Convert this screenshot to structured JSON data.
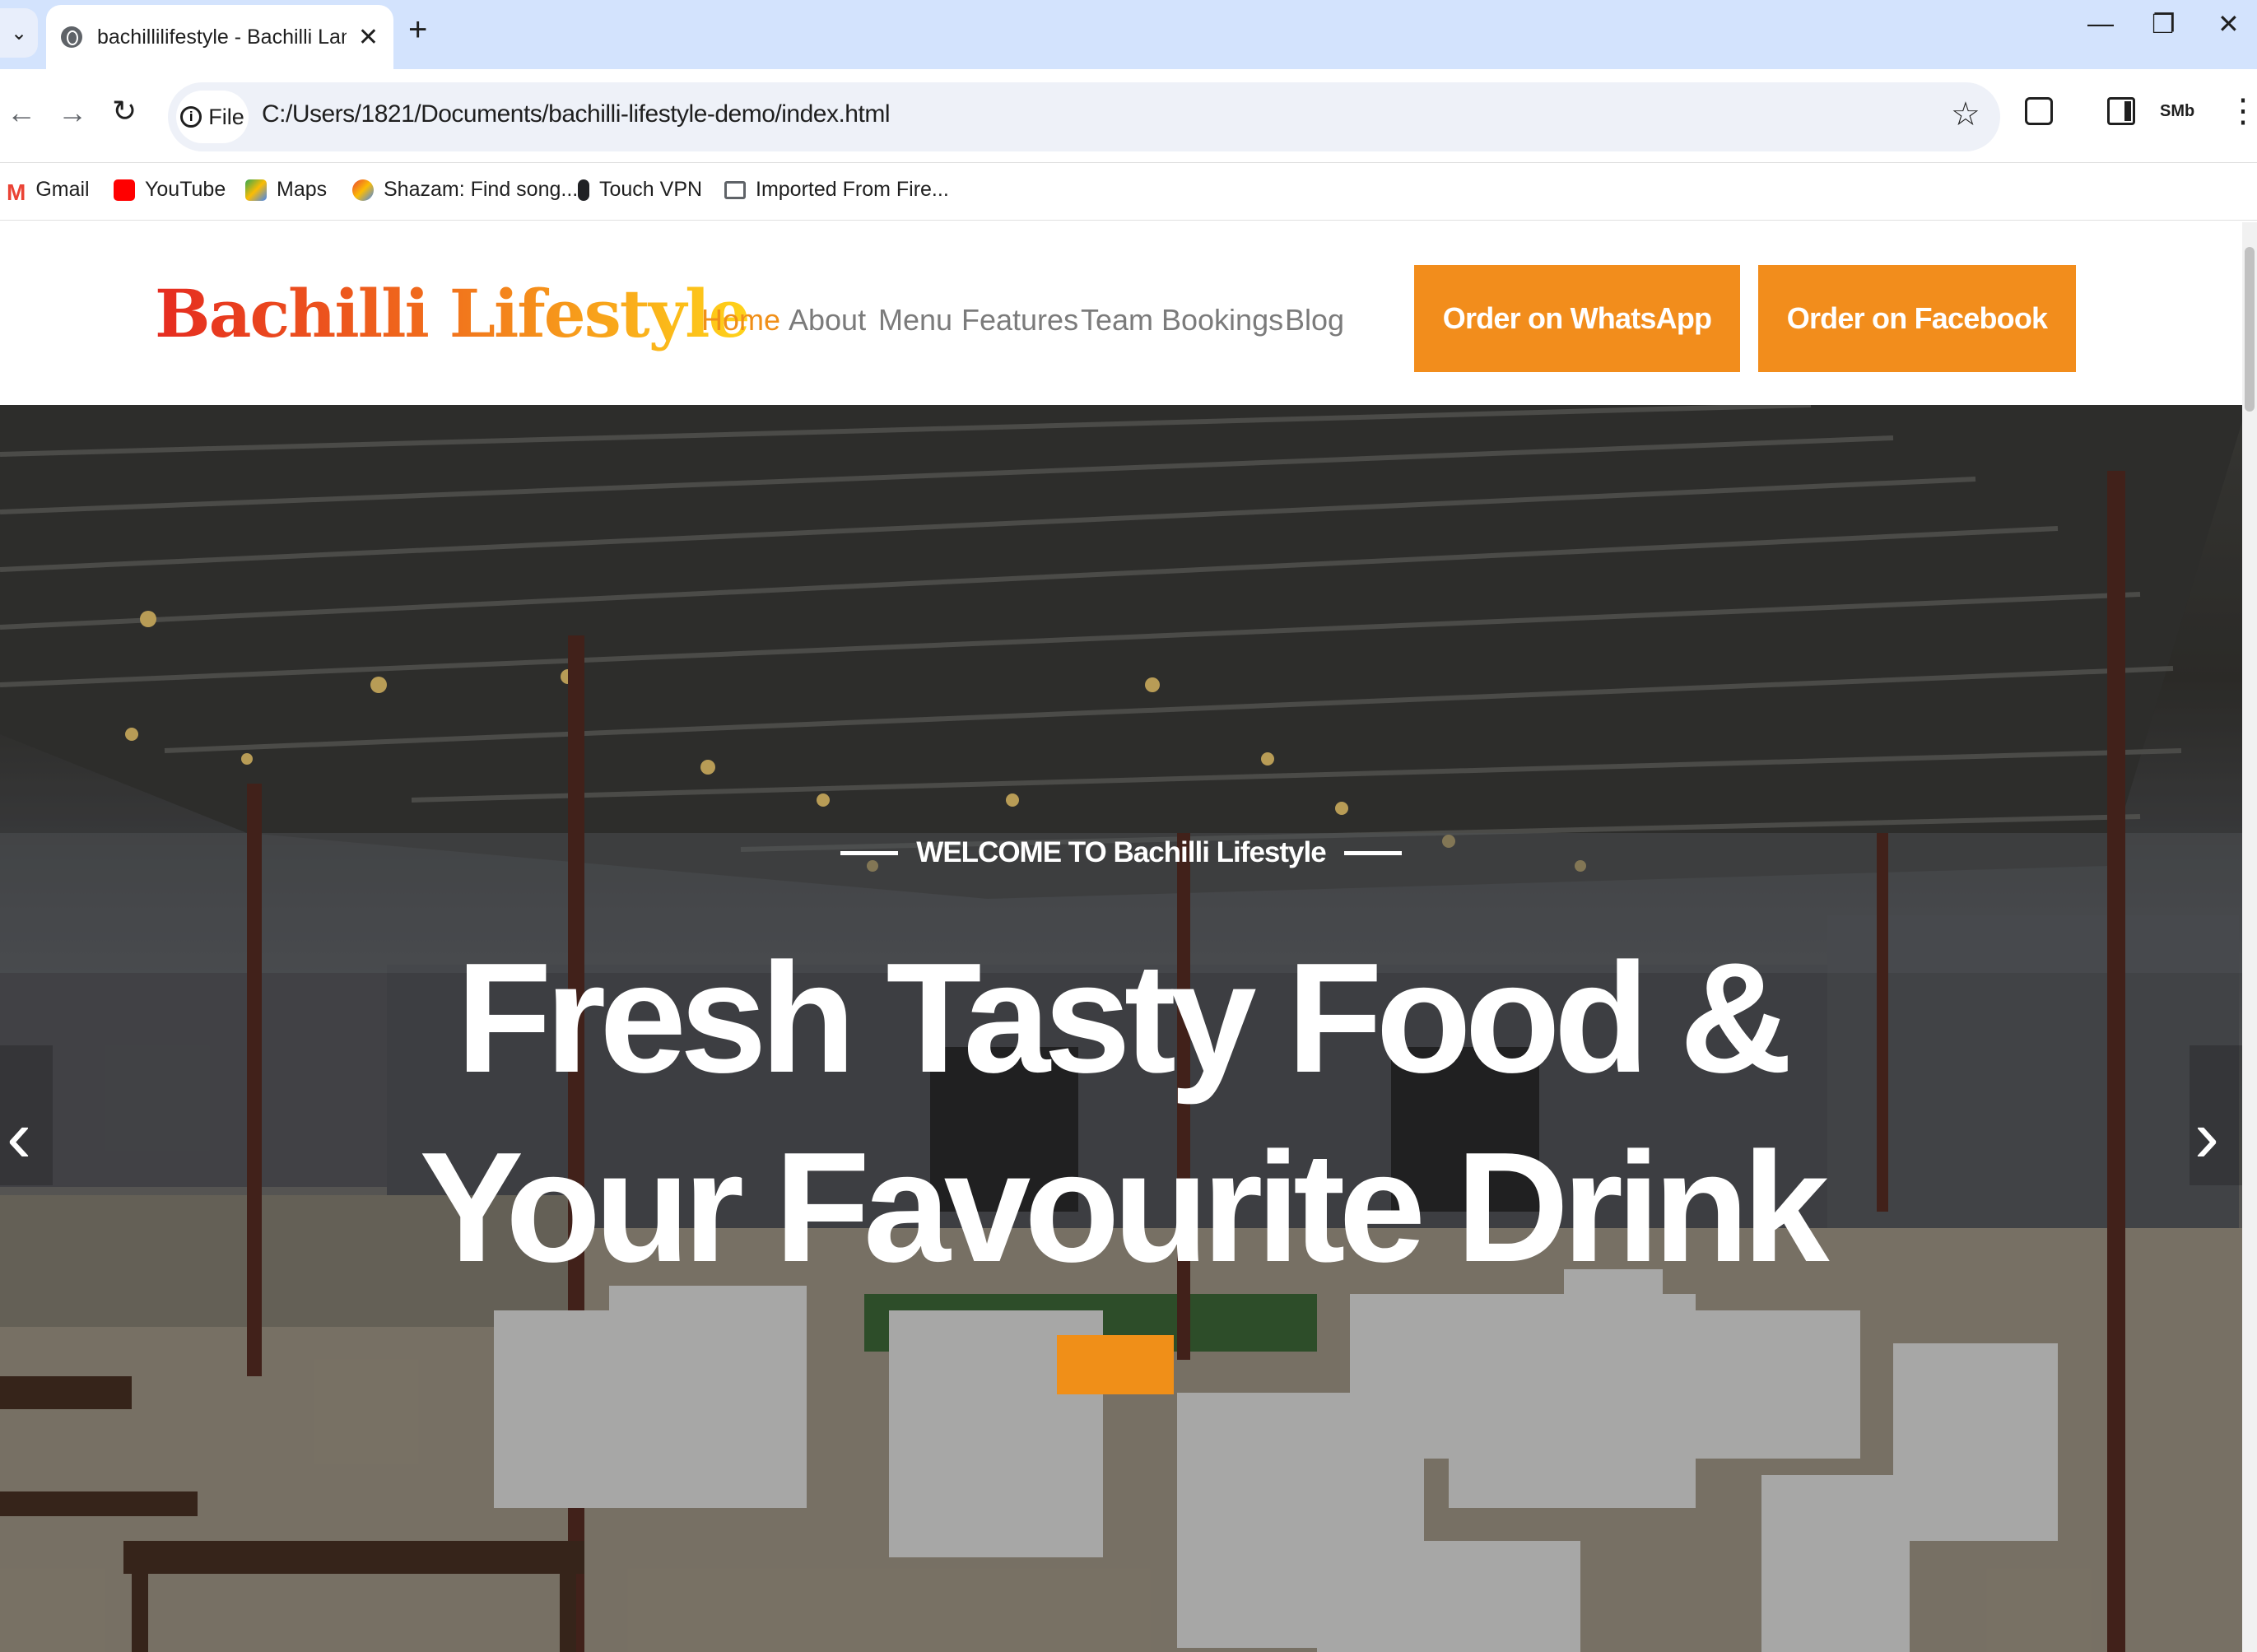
{
  "browser": {
    "tab_title": "bachillilifestyle - Bachilli Landing",
    "new_tab_label": "+",
    "minimize": "—",
    "restore": "❐",
    "close": "✕",
    "chip_label": "File",
    "url": "C:/Users/1821/Documents/bachilli-lifestyle-demo/index.html",
    "profile_label": "SMb",
    "bookmarks": [
      {
        "label": "Gmail",
        "color": "#ea4335"
      },
      {
        "label": "YouTube",
        "color": "#ff0000"
      },
      {
        "label": "Maps",
        "color": "#34a853"
      },
      {
        "label": "Shazam: Find song...",
        "color": "#1a73e8"
      },
      {
        "label": "Touch VPN",
        "color": "#202124"
      },
      {
        "label": "Imported From Fire...",
        "color": "#5f6368"
      }
    ]
  },
  "site": {
    "logo": "Bachilli Lifestyle",
    "nav": [
      "Home",
      "About",
      "Menu",
      "Features",
      "Team",
      "Bookings",
      "Blog"
    ],
    "order_whatsapp": "Order on WhatsApp",
    "order_facebook": "Order on Facebook",
    "accent_color": "#f28d1c"
  },
  "hero": {
    "welcome": "WELCOME TO Bachilli Lifestyle",
    "title_line1": "Fresh Tasty Food &",
    "title_line2": "Your Favourite Drink",
    "prev_arrow": "‹",
    "next_arrow": "›"
  }
}
